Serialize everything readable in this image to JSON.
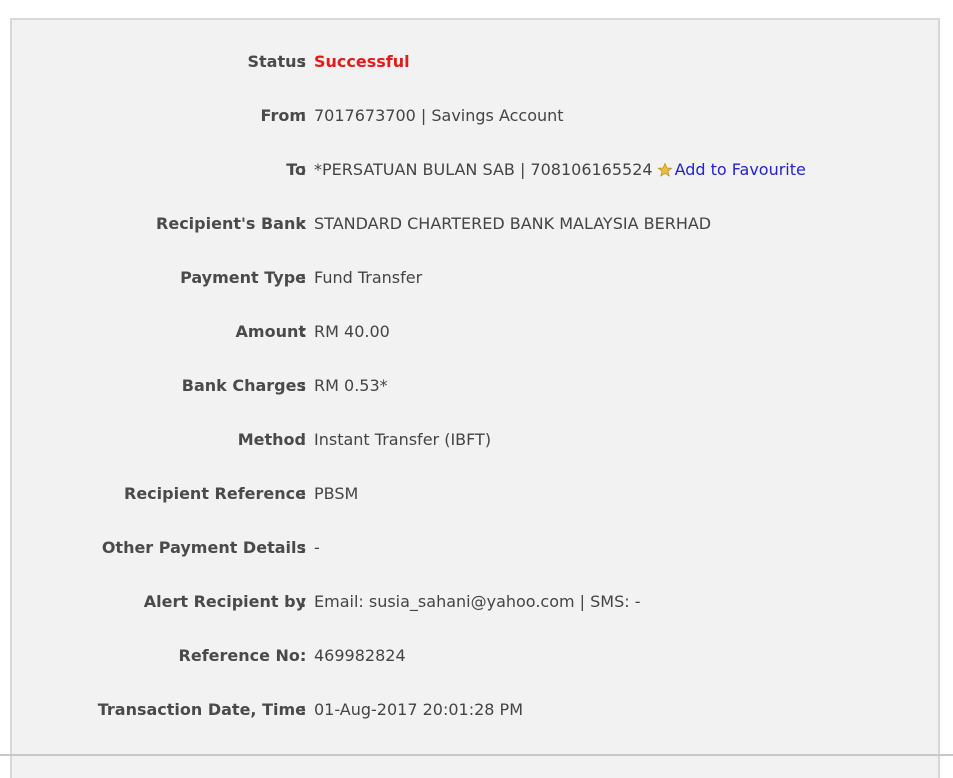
{
  "rows": [
    {
      "label": "Status",
      "value": "Successful"
    },
    {
      "label": "From",
      "value": "7017673700 | Savings Account"
    },
    {
      "label": "To",
      "value_prefix": "*PERSATUAN BULAN SAB | 708106165524",
      "link": "Add to Favourite"
    },
    {
      "label": "Recipient's Bank",
      "value": "STANDARD CHARTERED BANK MALAYSIA BERHAD"
    },
    {
      "label": "Payment Type",
      "value": "Fund Transfer"
    },
    {
      "label": "Amount",
      "value": "RM 40.00"
    },
    {
      "label": "Bank Charges",
      "value": "RM 0.53*"
    },
    {
      "label": "Method",
      "value": "Instant Transfer (IBFT)"
    },
    {
      "label": "Recipient Reference",
      "value": "PBSM"
    },
    {
      "label": "Other Payment Details",
      "value": "-"
    },
    {
      "label": "Alert Recipient by",
      "value": "Email: susia_sahani@yahoo.com | SMS: -"
    },
    {
      "label": "Reference No.",
      "value": "469982824"
    },
    {
      "label": "Transaction Date, Time",
      "value": "01-Aug-2017 20:01:28 PM"
    }
  ],
  "colon": ":",
  "colors": {
    "status_success": "#e31b1b",
    "link": "#2323c8",
    "panel_bg": "#f2f2f2",
    "star": "#e8c040"
  },
  "icons": {
    "favourite": "star-icon"
  }
}
